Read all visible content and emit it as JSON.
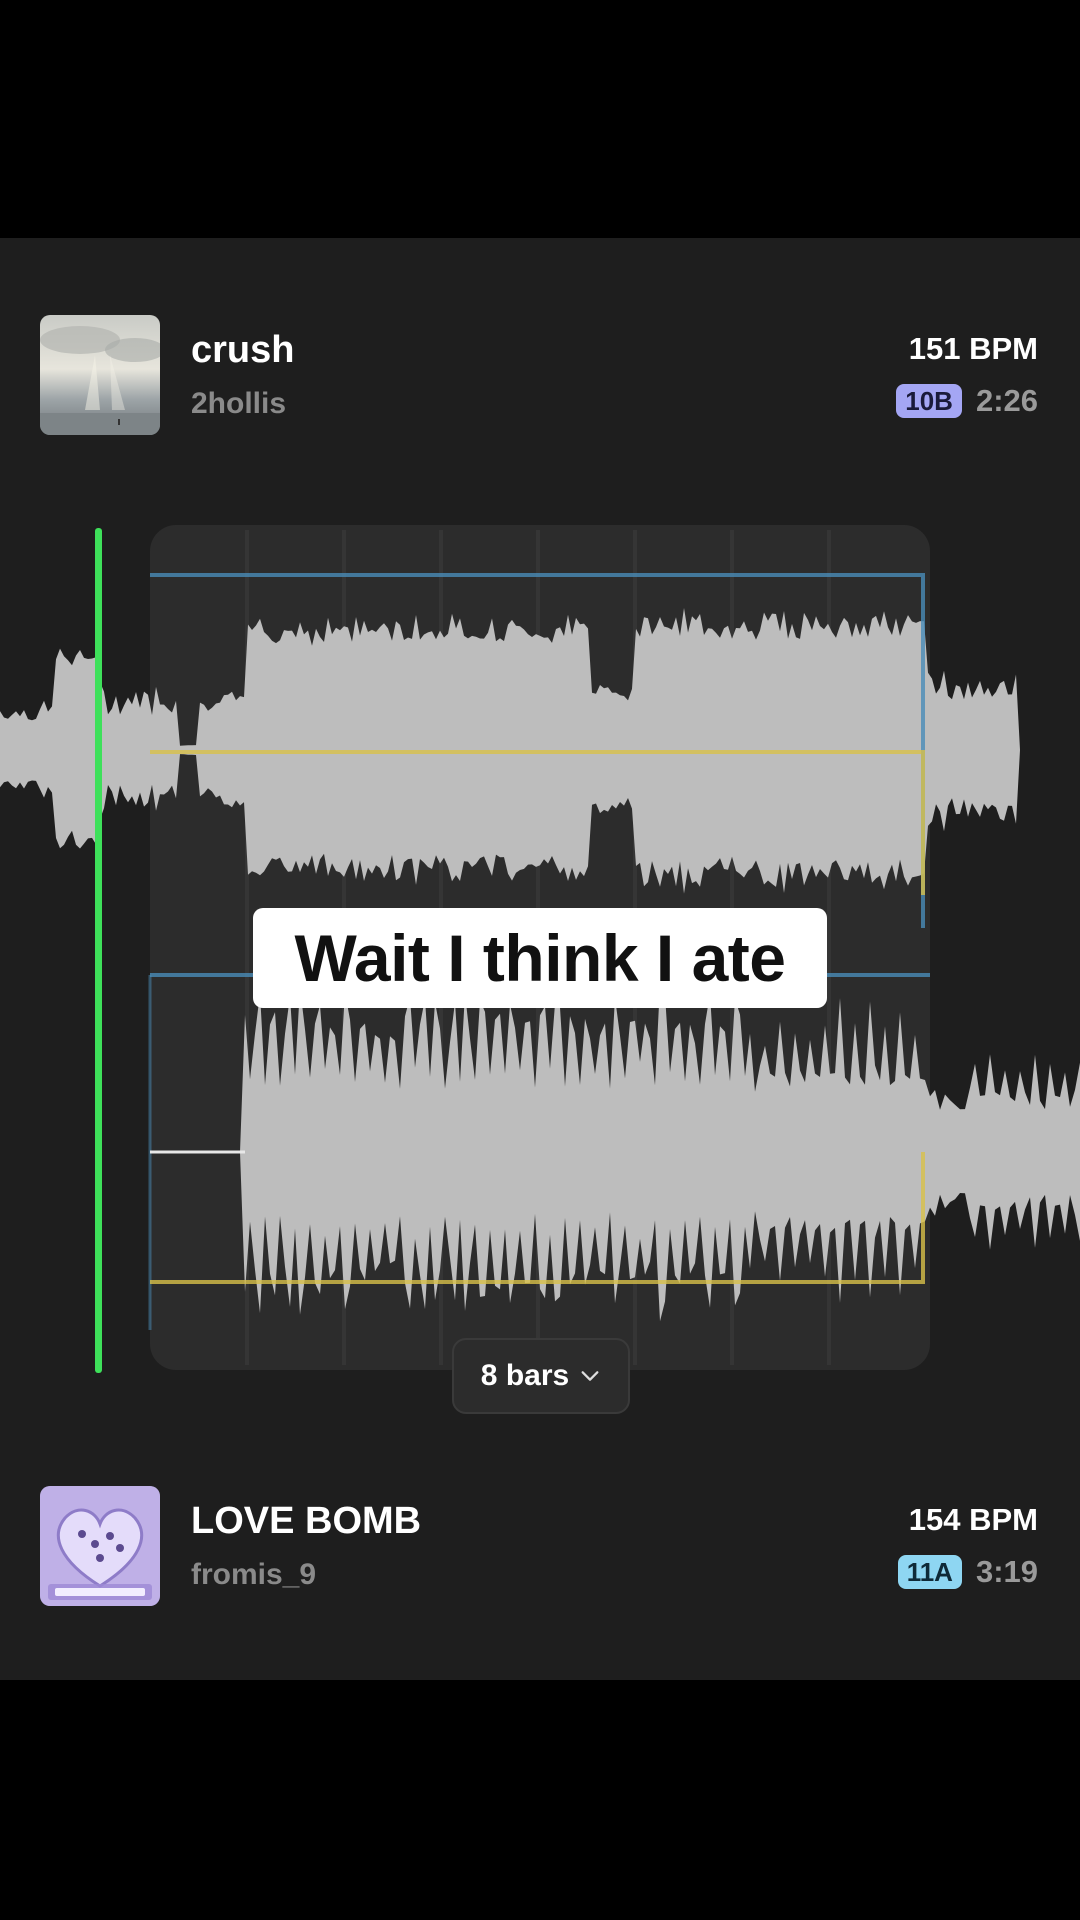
{
  "top_track": {
    "title": "crush",
    "artist": "2hollis",
    "bpm": "151 BPM",
    "key": "10B",
    "duration": "2:26"
  },
  "bottom_track": {
    "title": "LOVE BOMB",
    "artist": "fromis_9",
    "bpm": "154 BPM",
    "key": "11A",
    "duration": "3:19"
  },
  "caption": "Wait I think I ate",
  "bars_selector": {
    "label": "8 bars",
    "icon": "chevron-down-icon"
  },
  "colors": {
    "playhead": "#3ee05a",
    "key_10b": "#a4a6f4",
    "key_11a": "#8ed6f2",
    "guide_blue": "#4a8cb8",
    "guide_yellow": "#d8c04a",
    "waveform": "#bdbdbd"
  }
}
